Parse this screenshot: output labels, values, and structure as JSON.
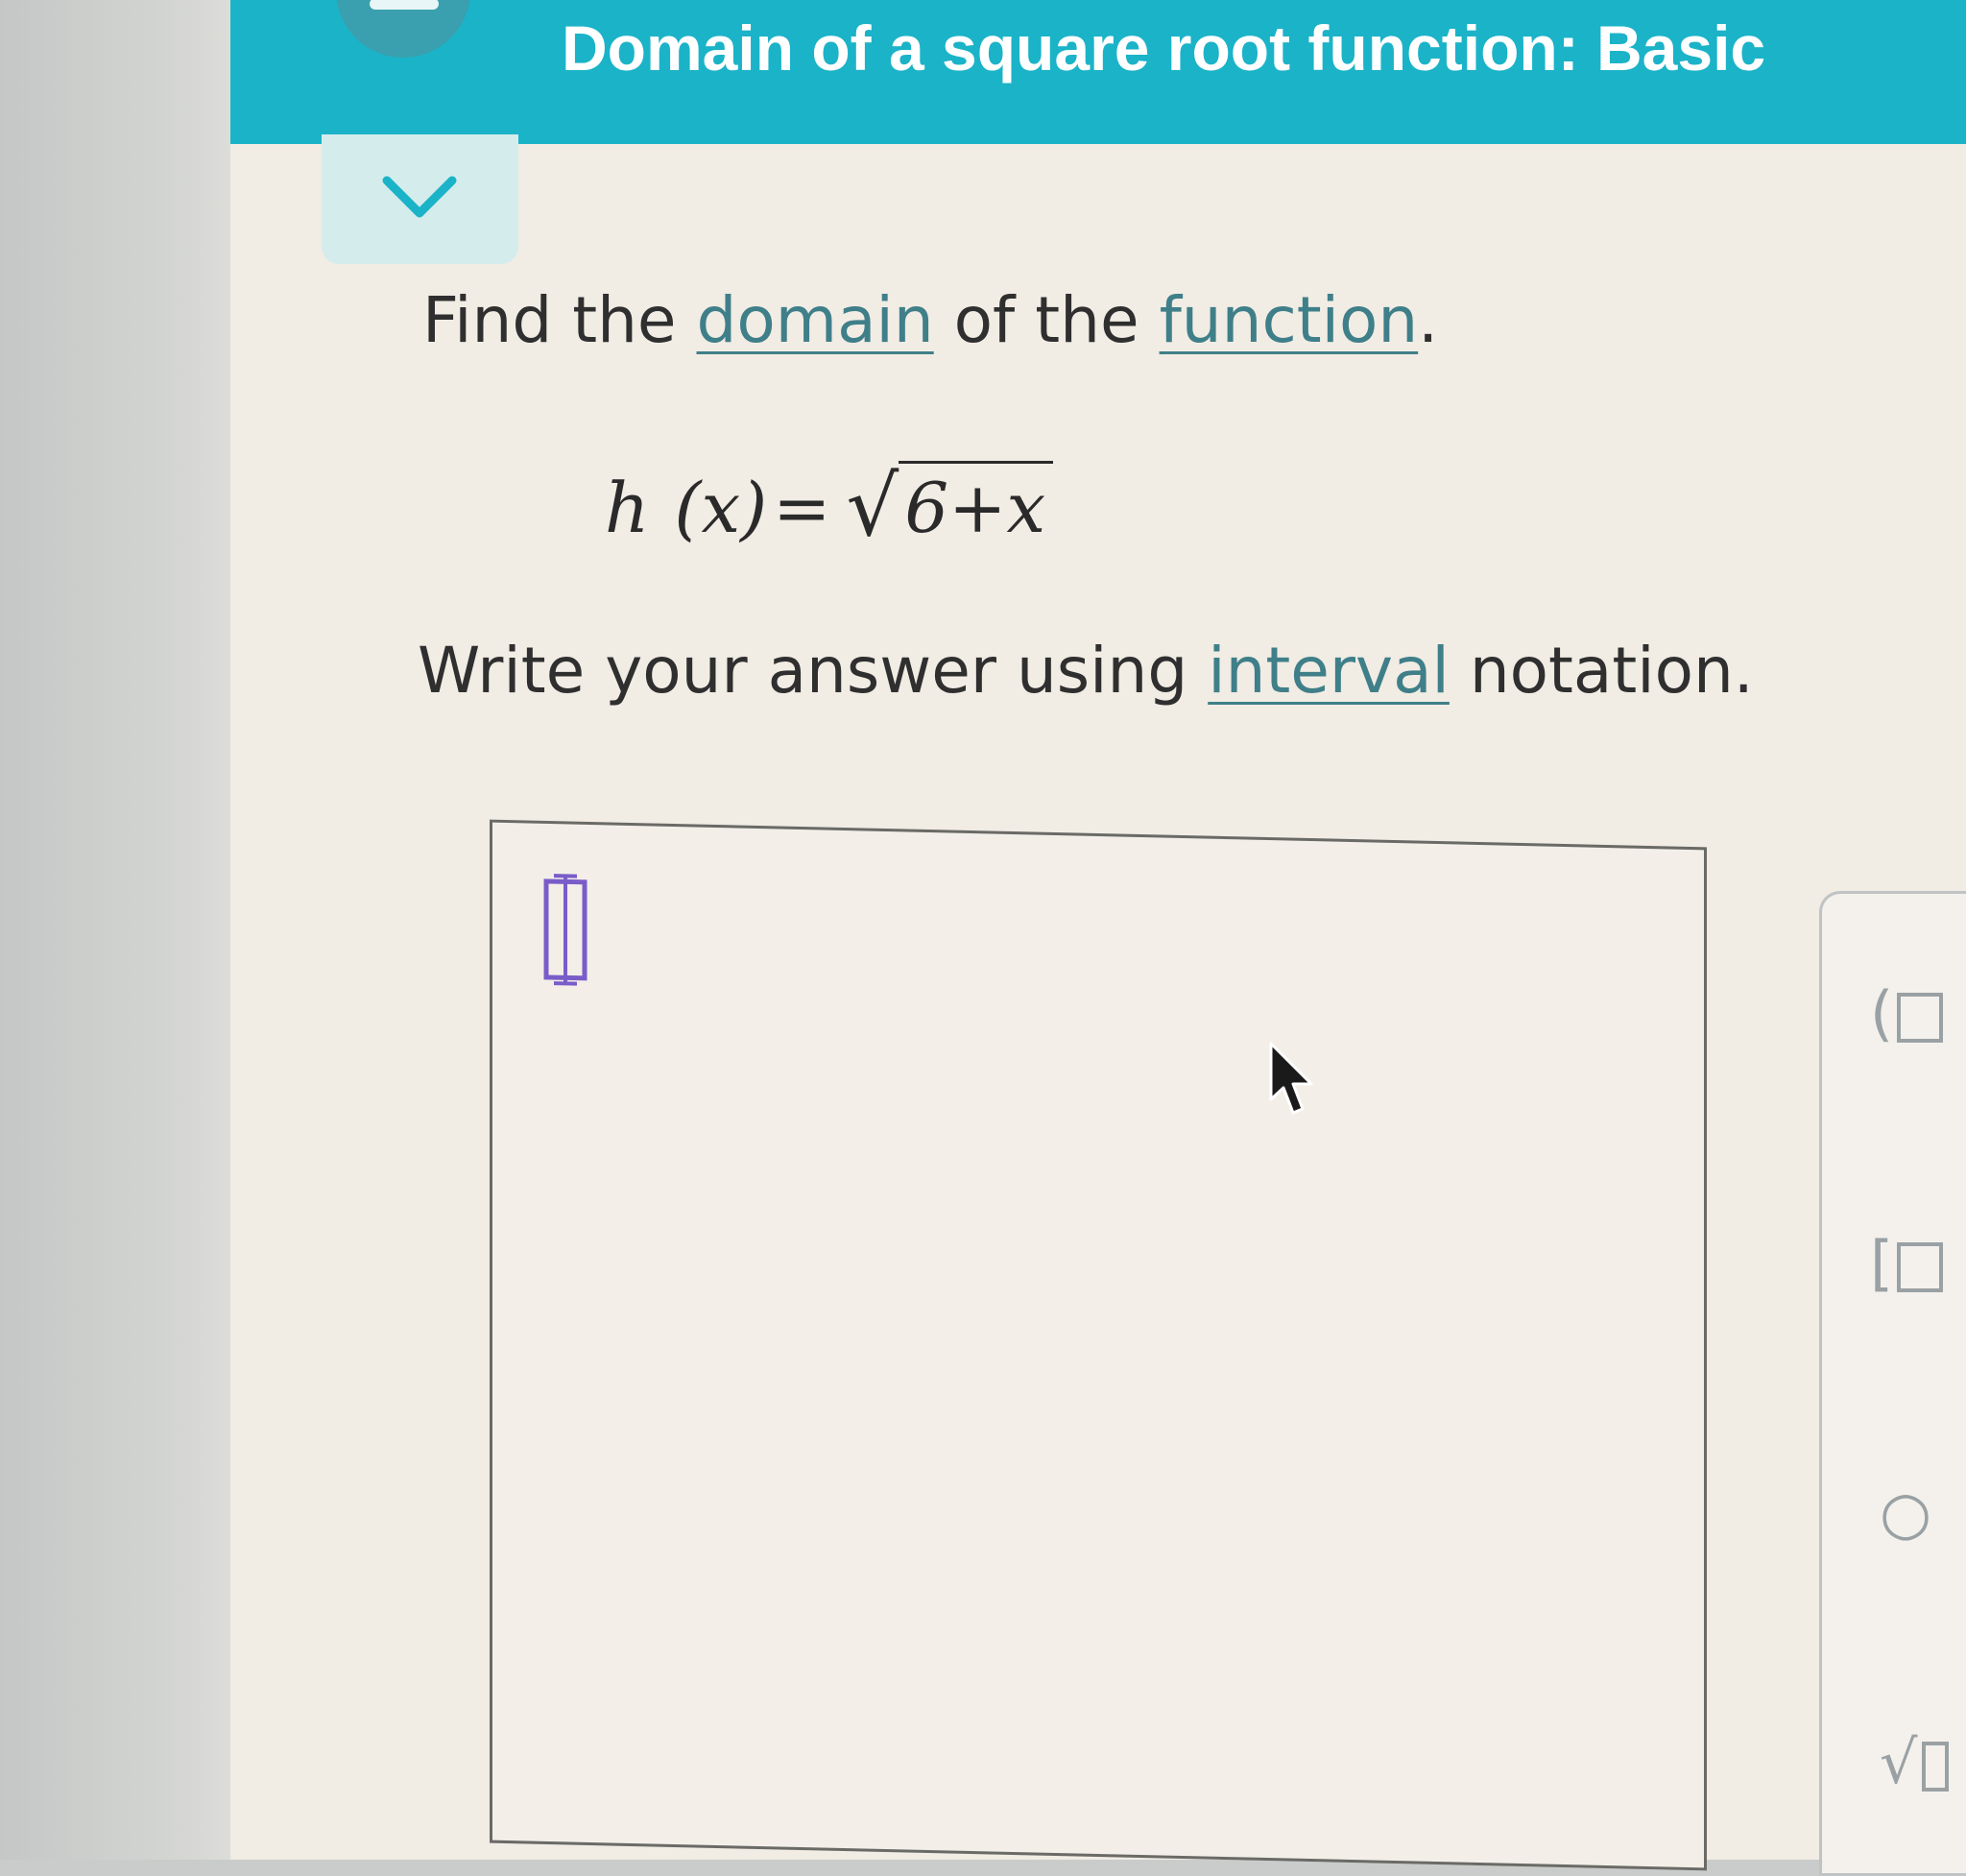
{
  "header": {
    "title": "Domain of a square root function: Basic"
  },
  "question": {
    "prompt_before": "Find the ",
    "link_domain": "domain",
    "prompt_middle": " of the ",
    "link_function": "function",
    "prompt_end": ".",
    "equation": {
      "fn_name": "h",
      "argument": "(x)",
      "equals": "=",
      "radicand": "6+x"
    },
    "instruction_before": "Write your answer using ",
    "link_interval": "interval",
    "instruction_after": " notation."
  },
  "answer": {
    "value": ""
  },
  "keypad": {
    "keys": [
      "(",
      "[",
      "○",
      "√"
    ]
  },
  "colors": {
    "header": "#1bb3c8",
    "link": "#3f7f89",
    "cursor": "#7a5cc9"
  }
}
